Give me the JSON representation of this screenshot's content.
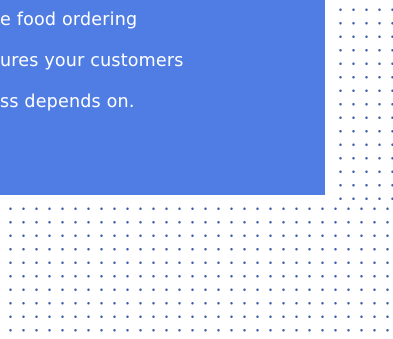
{
  "colors": {
    "accent": "#4f7de4",
    "dot": "#3f5fa6",
    "text": "#ffffff"
  },
  "card": {
    "lines": [
      "e food ordering",
      "ures your customers",
      "ss depends on."
    ]
  }
}
